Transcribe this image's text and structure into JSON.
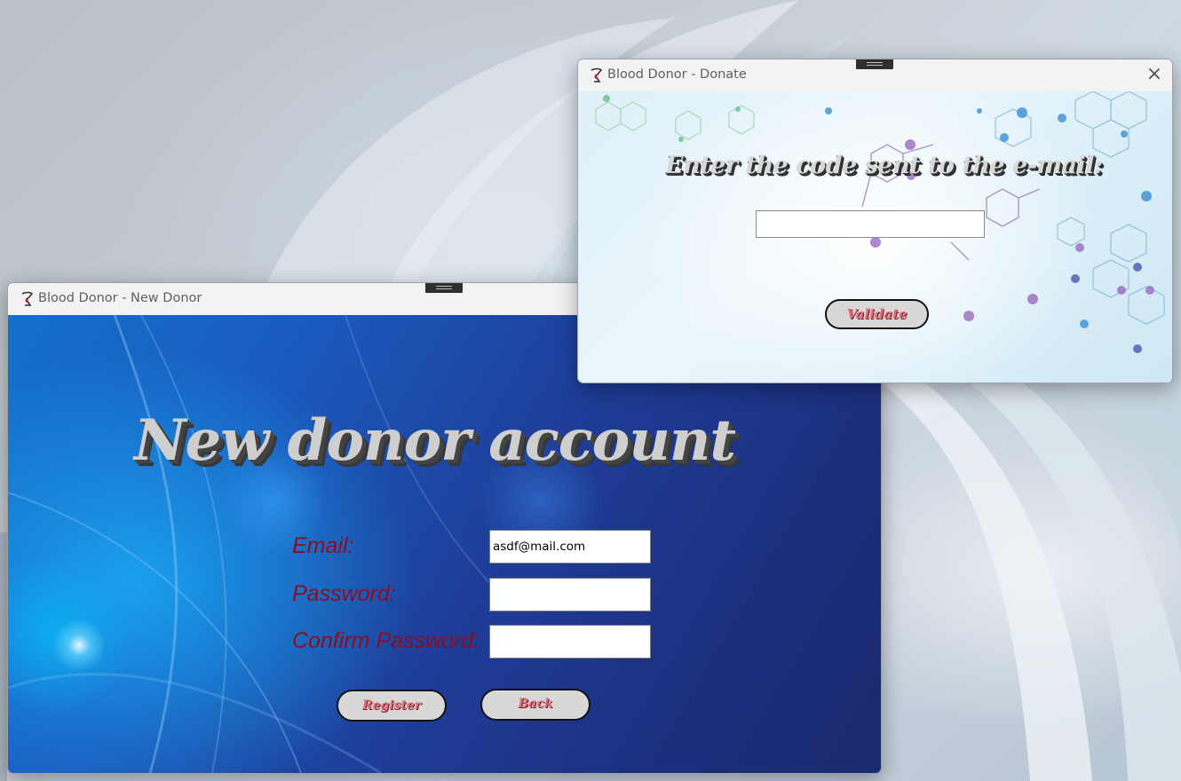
{
  "new_donor_window": {
    "title": "Blood Donor - New Donor",
    "heading": "New donor account",
    "fields": {
      "email_label": "Email:",
      "email_value": "asdf@mail.com",
      "password_label": "Password:",
      "password_value": "",
      "confirm_label": "Confirm Password:",
      "confirm_value": ""
    },
    "buttons": {
      "register": "Register",
      "back": "Back"
    }
  },
  "donate_window": {
    "title": "Blood Donor - Donate",
    "heading": "Enter the code sent to the e-mail:",
    "code_value": "",
    "close_glyph": "×",
    "validate": "Validate"
  },
  "colors": {
    "label": "#8b0e1e",
    "button_text": "#e26d7a",
    "button_bg": "#d8d8d8"
  }
}
